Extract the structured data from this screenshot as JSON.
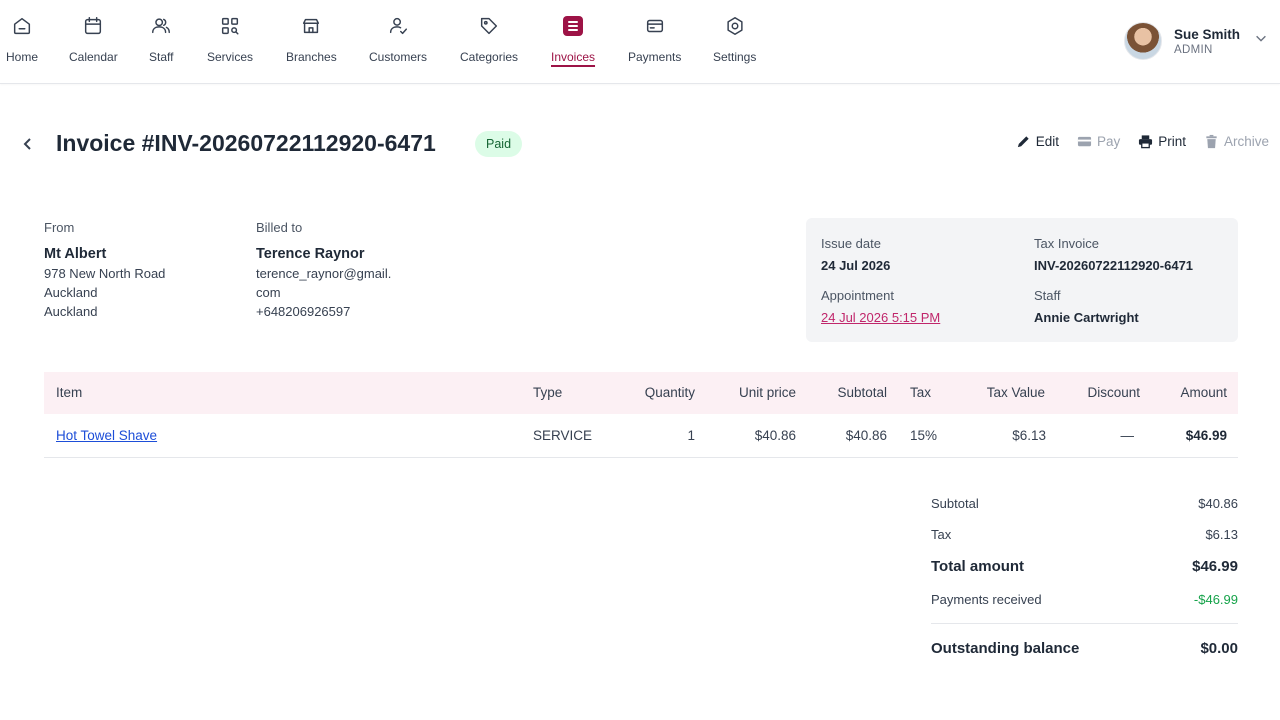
{
  "nav": {
    "items": [
      {
        "label": "Home",
        "icon": "home-icon"
      },
      {
        "label": "Calendar",
        "icon": "calendar-icon"
      },
      {
        "label": "Staff",
        "icon": "users-icon"
      },
      {
        "label": "Services",
        "icon": "grid-search-icon"
      },
      {
        "label": "Branches",
        "icon": "store-icon"
      },
      {
        "label": "Customers",
        "icon": "user-check-icon"
      },
      {
        "label": "Categories",
        "icon": "tag-icon"
      },
      {
        "label": "Invoices",
        "icon": "invoice-icon",
        "active": true
      },
      {
        "label": "Payments",
        "icon": "card-icon"
      },
      {
        "label": "Settings",
        "icon": "settings-icon"
      }
    ],
    "accent": "#9d1346"
  },
  "user": {
    "name": "Sue Smith",
    "role": "ADMIN"
  },
  "header": {
    "title": "Invoice #INV-20260722112920-6471",
    "status": "Paid",
    "actions": {
      "edit": "Edit",
      "pay": "Pay",
      "print": "Print",
      "archive": "Archive"
    }
  },
  "from": {
    "label": "From",
    "name": "Mt Albert",
    "address": [
      "978 New North Road",
      "Auckland",
      "Auckland"
    ]
  },
  "billed": {
    "label": "Billed to",
    "name": "Terence Raynor",
    "email_line1": "terence_raynor@gmail.",
    "email_line2": "com",
    "phone": "+648206926597"
  },
  "meta": {
    "issue_date_label": "Issue date",
    "issue_date": "24 Jul 2026",
    "tax_invoice_label": "Tax Invoice",
    "tax_invoice": "INV-20260722112920-6471",
    "appointment_label": "Appointment",
    "appointment": "24 Jul 2026 5:15 PM",
    "staff_label": "Staff",
    "staff": "Annie Cartwright"
  },
  "table": {
    "headers": {
      "item": "Item",
      "type": "Type",
      "quantity": "Quantity",
      "unit_price": "Unit price",
      "subtotal": "Subtotal",
      "tax": "Tax",
      "tax_value": "Tax Value",
      "discount": "Discount",
      "amount": "Amount"
    },
    "rows": [
      {
        "item": "Hot Towel Shave",
        "type": "SERVICE",
        "quantity": "1",
        "unit_price": "$40.86",
        "subtotal": "$40.86",
        "tax": "15%",
        "tax_value": "$6.13",
        "discount": "—",
        "amount": "$46.99"
      }
    ]
  },
  "totals": {
    "subtotal_label": "Subtotal",
    "subtotal": "$40.86",
    "tax_label": "Tax",
    "tax": "$6.13",
    "total_label": "Total amount",
    "total": "$46.99",
    "payments_label": "Payments received",
    "payments": "-$46.99",
    "outstanding_label": "Outstanding balance",
    "outstanding": "$0.00"
  }
}
